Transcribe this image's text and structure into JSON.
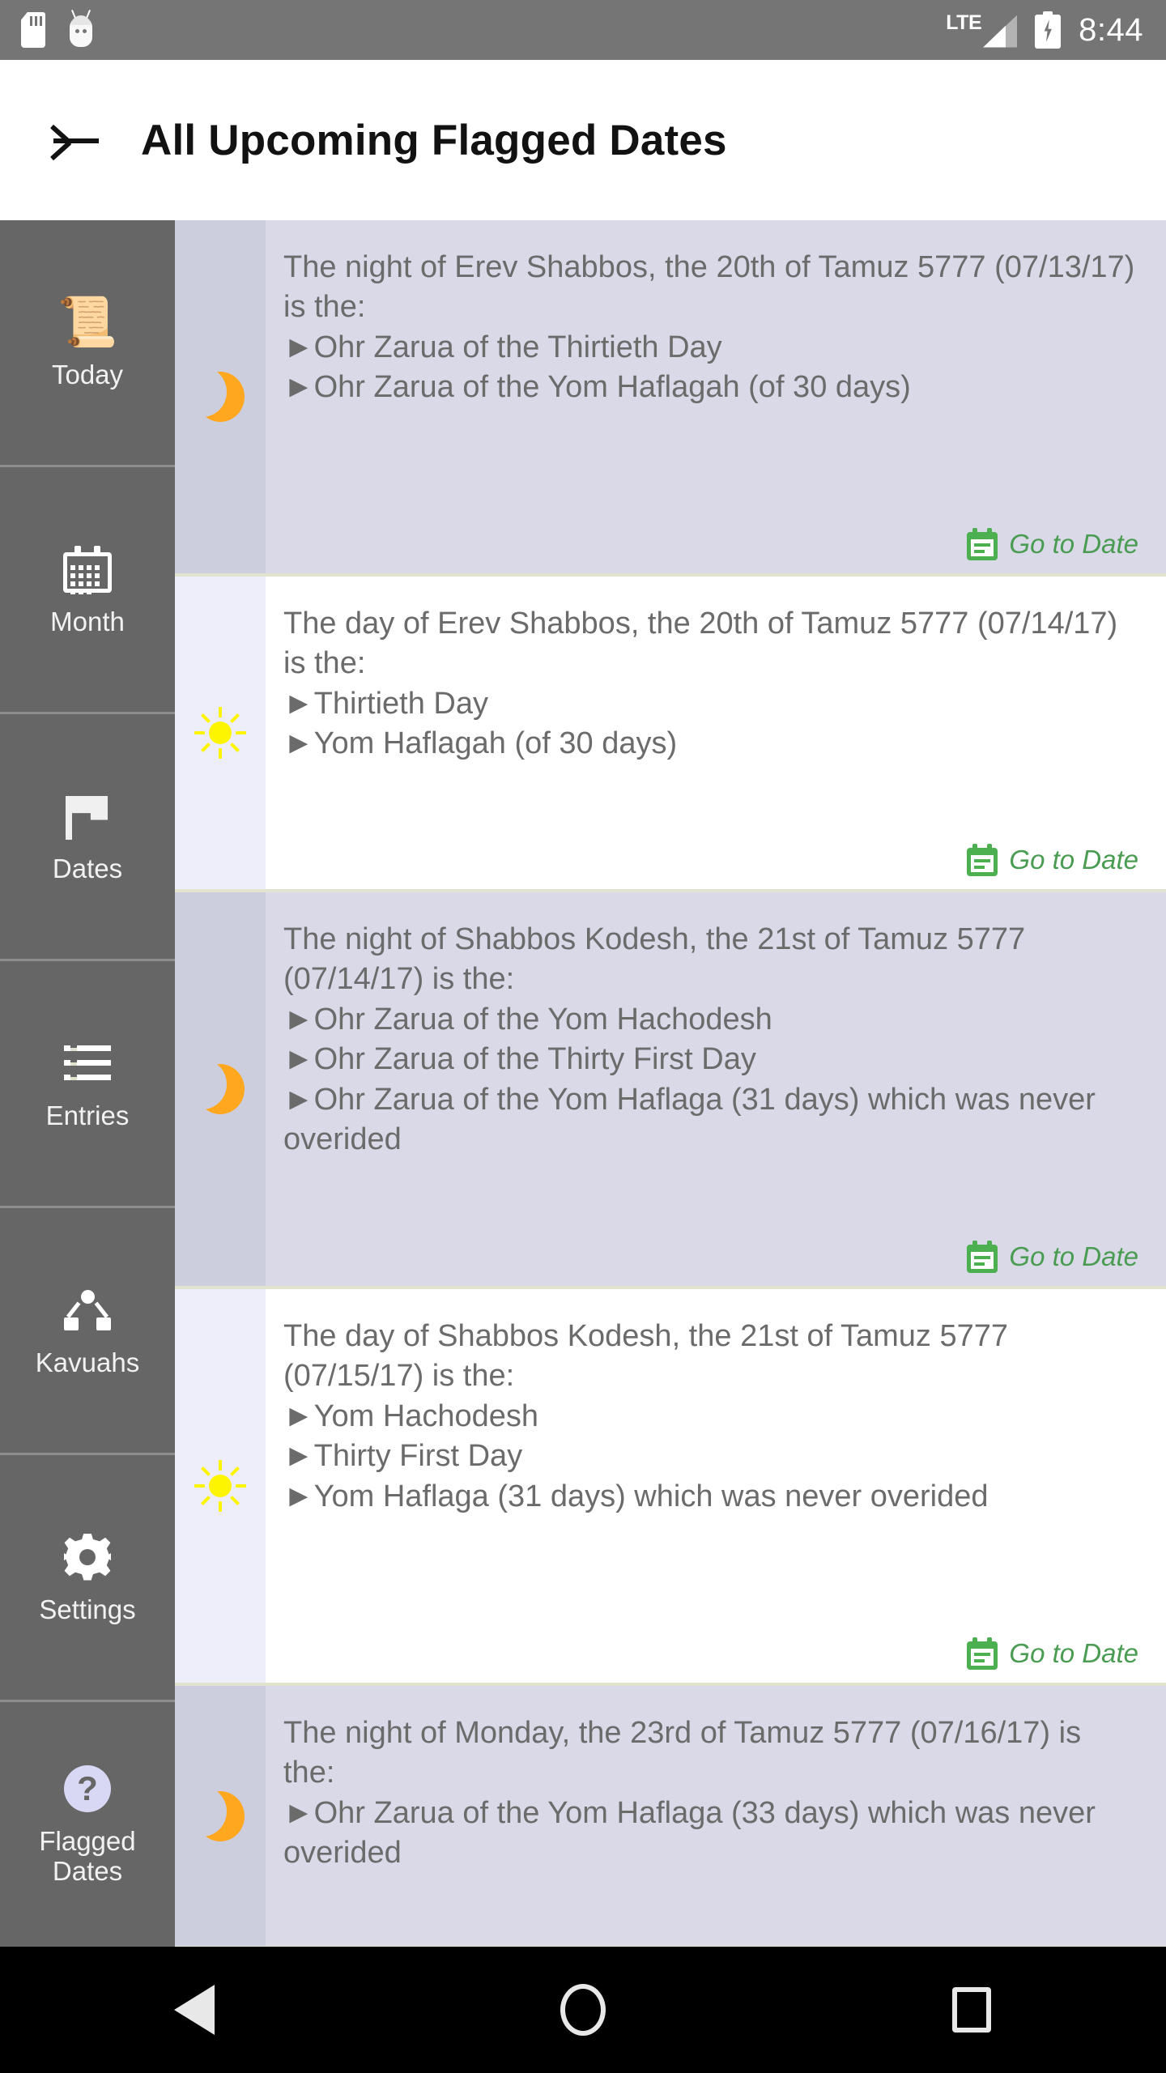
{
  "status_bar": {
    "icons": [
      "sd-card-icon",
      "android-head-icon"
    ],
    "network": "LTE",
    "battery": "charging",
    "time": "8:44"
  },
  "app_bar": {
    "back_icon": "back-arrow-icon",
    "title": "All Upcoming Flagged Dates"
  },
  "sidebar": {
    "items": [
      {
        "label": "Today",
        "icon": "scroll-icon"
      },
      {
        "label": "Month",
        "icon": "calendar-icon"
      },
      {
        "label": "Dates",
        "icon": "flag-icon"
      },
      {
        "label": "Entries",
        "icon": "list-icon"
      },
      {
        "label": "Kavuahs",
        "icon": "hierarchy-icon"
      },
      {
        "label": "Settings",
        "icon": "gear-icon"
      },
      {
        "label": "Flagged\nDates",
        "icon": "question-circle-icon"
      }
    ]
  },
  "list": {
    "goto_label": "Go to Date",
    "goto_icon": "calendar-goto-icon",
    "items": [
      {
        "period": "night",
        "icon": "moon-icon",
        "text": "The night of Erev Shabbos, the 20th of Tamuz 5777 (07/13/17) is the:\n ►Ohr Zarua of the Thirtieth Day\n ►Ohr Zarua of the Yom Haflagah (of 30 days)"
      },
      {
        "period": "day",
        "icon": "sun-icon",
        "text": "The day of Erev Shabbos, the 20th of Tamuz 5777 (07/14/17) is the:\n ►Thirtieth Day\n ►Yom Haflagah (of 30 days)"
      },
      {
        "period": "night",
        "icon": "moon-icon",
        "text": "The night of Shabbos Kodesh, the 21st of Tamuz 5777 (07/14/17) is the:\n ►Ohr Zarua of the Yom Hachodesh\n ►Ohr Zarua of the Thirty First Day\n ►Ohr Zarua of the Yom Haflaga (31 days) which was never overided"
      },
      {
        "period": "day",
        "icon": "sun-icon",
        "text": "The day of Shabbos Kodesh, the 21st of Tamuz 5777 (07/15/17) is the:\n ►Yom Hachodesh\n ►Thirty First Day\n ►Yom Haflaga (31 days) which was never overided"
      },
      {
        "period": "night",
        "icon": "moon-icon",
        "text": "The night of Monday, the 23rd of Tamuz 5777 (07/16/17) is the:\n ►Ohr Zarua of the Yom Haflaga (33 days) which was never overided"
      }
    ]
  },
  "nav_bar": {
    "back": "nav-back-icon",
    "home": "nav-home-icon",
    "recents": "nav-recents-icon"
  },
  "colors": {
    "status_bar_bg": "#757575",
    "sidebar_bg": "#666666",
    "night_row_bg": "#d9d9e8",
    "day_row_bg": "#ffffff",
    "divider": "#e2e3cf",
    "goto_green": "#4a9c52",
    "moon_orange": "#ffa71e",
    "sun_yellow": "#fdf500",
    "help_badge": "#d8d7f4"
  }
}
